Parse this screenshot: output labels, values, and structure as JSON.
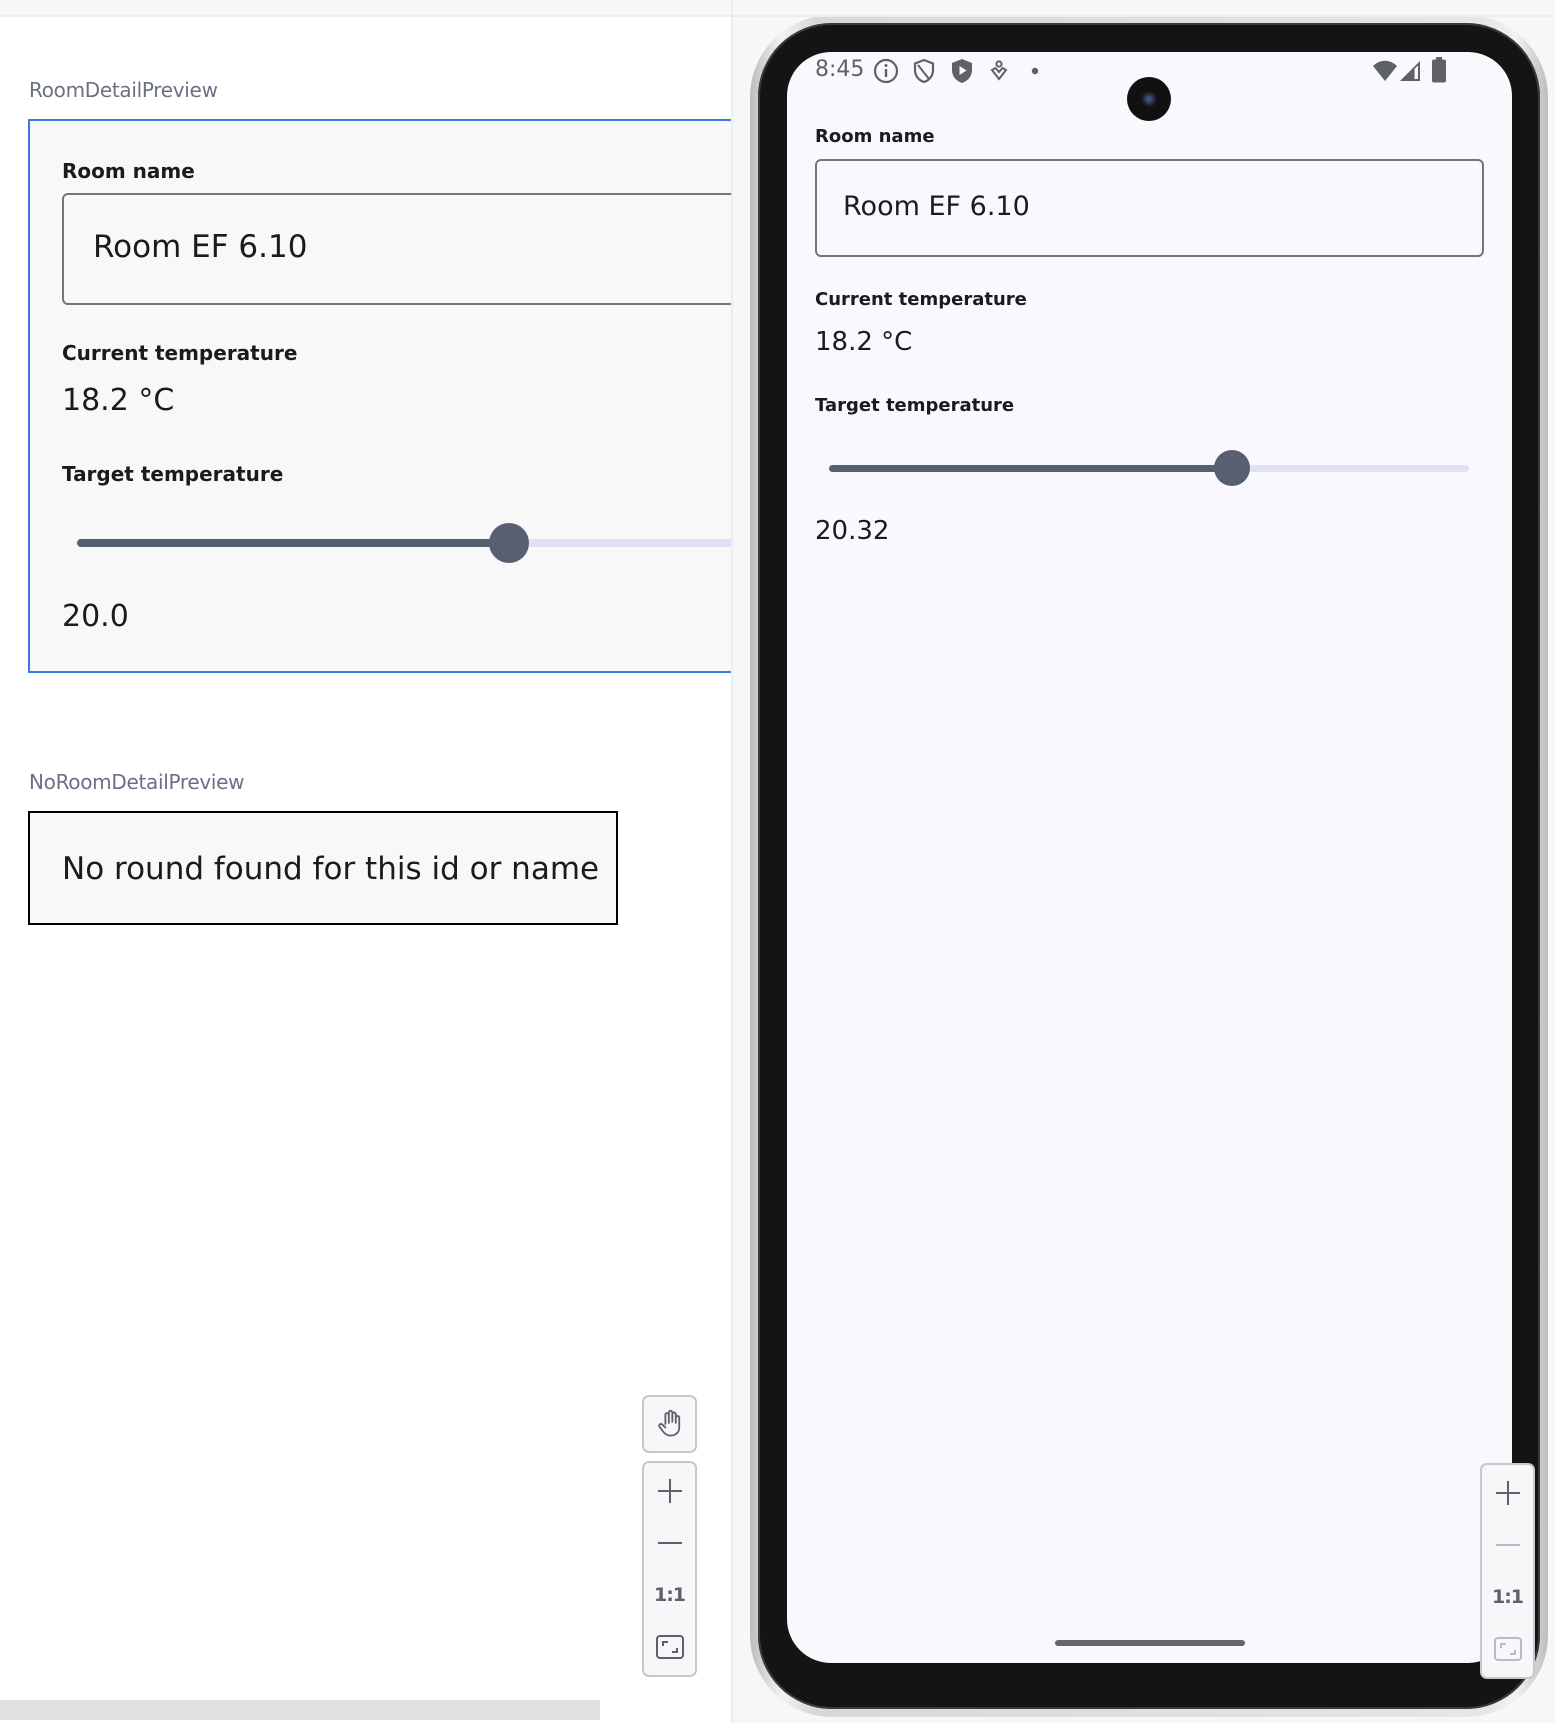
{
  "left_panel": {
    "previews": [
      {
        "title": "RoomDetailPreview",
        "room_name_label": "Room name",
        "room_name_value": "Room EF 6.10",
        "current_temp_label": "Current temperature",
        "current_temp_value": "18.2 °C",
        "target_temp_label": "Target temperature",
        "target_slider_fraction": 0.6,
        "target_temp_value": "20.0"
      },
      {
        "title": "NoRoomDetailPreview",
        "message": "No round found for this id or name"
      }
    ],
    "toolbar": {
      "pan_icon": "hand-icon",
      "zoom_in_icon": "plus-icon",
      "zoom_out_icon": "minus-icon",
      "actual_size_label": "1:1",
      "fit_icon": "fit-screen-icon"
    }
  },
  "device": {
    "status_bar": {
      "time": "8:45",
      "left_icons": [
        "info-icon",
        "shield-outline-icon",
        "shield-play-icon",
        "accessibility-icon",
        "notification-dot-icon"
      ],
      "right_icons": [
        "wifi-icon",
        "signal-icon",
        "battery-icon"
      ]
    },
    "screen": {
      "room_name_label": "Room name",
      "room_name_value": "Room EF 6.10",
      "current_temp_label": "Current temperature",
      "current_temp_value": "18.2 °C",
      "target_temp_label": "Target temperature",
      "target_slider_fraction": 0.63,
      "target_temp_value": "20.32"
    },
    "toolbar": {
      "zoom_in_icon": "plus-icon",
      "zoom_out_icon": "minus-icon",
      "actual_size_label": "1:1",
      "fit_icon": "fit-screen-icon"
    }
  },
  "colors": {
    "selection_border": "#3b78e7",
    "slider_active": "#585f71",
    "slider_inactive": "#dfe1f6",
    "preview_label": "#6b7183"
  }
}
